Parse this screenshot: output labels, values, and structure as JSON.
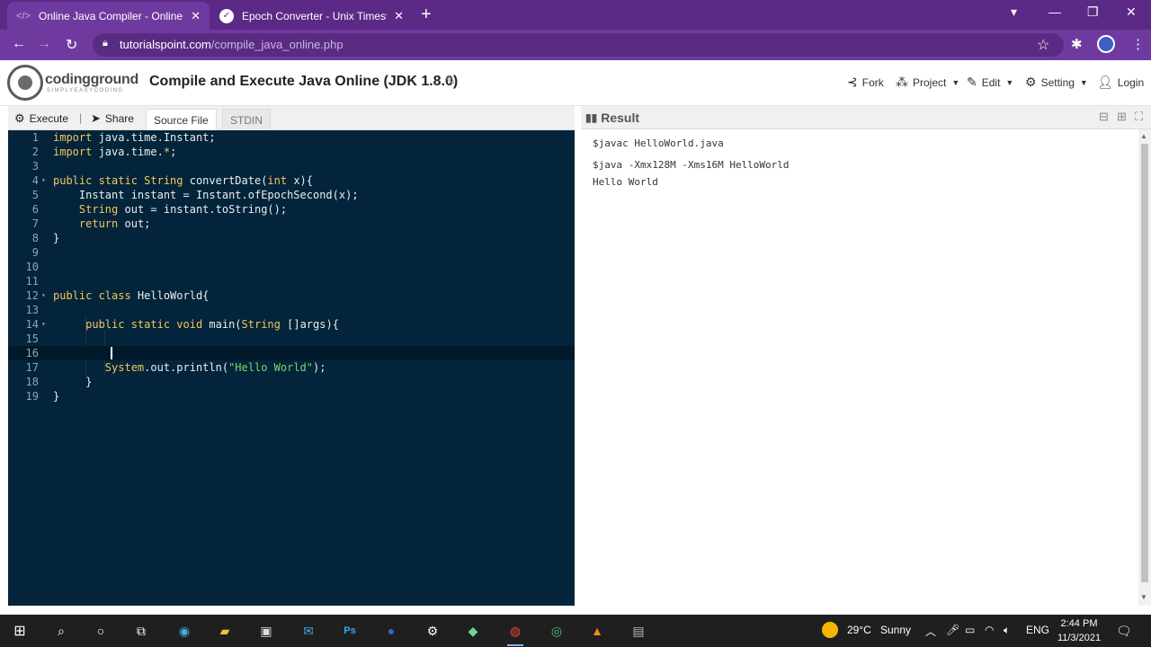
{
  "browser": {
    "tabs": [
      {
        "label": "Online Java Compiler - Online Ja",
        "close": "✕",
        "icon": "code-icon"
      },
      {
        "label": "Epoch Converter - Unix Timestam",
        "close": "✕",
        "icon": "epoch-icon"
      }
    ],
    "new_tab": "+",
    "url_host": "tutorialspoint.com",
    "url_path": "/compile_java_online.php"
  },
  "site": {
    "logo_text": "codingground",
    "logo_sub": "SIMPLYEASYCODING",
    "page_title": "Compile and Execute Java Online (JDK 1.8.0)",
    "menu": {
      "fork": "Fork",
      "project": "Project",
      "edit": "Edit",
      "setting": "Setting",
      "login": "Login"
    }
  },
  "toolbar": {
    "execute": "Execute",
    "separator": "|",
    "share": "Share",
    "source_file": "Source File",
    "stdin": "STDIN"
  },
  "editor": {
    "line_numbers": [
      "1",
      "2",
      "3",
      "4",
      "5",
      "6",
      "7",
      "8",
      "9",
      "10",
      "11",
      "12",
      "13",
      "14",
      "15",
      "16",
      "17",
      "18",
      "19"
    ],
    "current_line": 16
  },
  "result": {
    "title": "Result",
    "lines": [
      "$javac HelloWorld.java",
      "$java -Xmx128M -Xms16M HelloWorld",
      "Hello World"
    ]
  },
  "taskbar": {
    "weather_temp": "29°C",
    "weather_desc": "Sunny",
    "language": "ENG",
    "time": "2:44 PM",
    "date": "11/3/2021"
  },
  "colors": {
    "browser_frame": "#5b2a86",
    "editor_bg": "#03243a",
    "keyword": "#f2c75f",
    "string": "#79d86a"
  }
}
